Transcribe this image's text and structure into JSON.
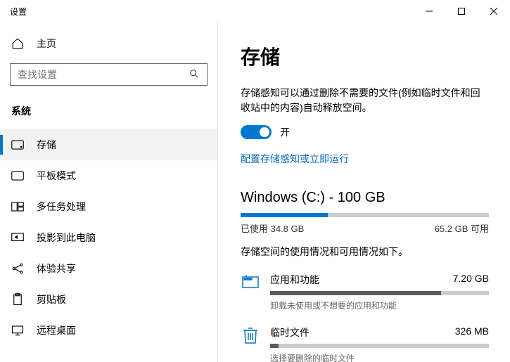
{
  "window": {
    "title": "设置"
  },
  "sidebar": {
    "home": "主页",
    "search_placeholder": "查找设置",
    "section": "系统",
    "items": [
      {
        "label": "存储"
      },
      {
        "label": "平板模式"
      },
      {
        "label": "多任务处理"
      },
      {
        "label": "投影到此电脑"
      },
      {
        "label": "体验共享"
      },
      {
        "label": "剪贴板"
      },
      {
        "label": "远程桌面"
      }
    ]
  },
  "main": {
    "title": "存储",
    "description": "存储感知可以通过删除不需要的文件(例如临时文件和回收站中的内容)自动释放空间。",
    "toggle_state": "开",
    "config_link": "配置存储感知或立即运行",
    "drive": {
      "title": "Windows (C:) - 100 GB",
      "used_pct": 35,
      "used_text": "已使用 34.8 GB",
      "free_text": "65.2 GB 可用",
      "sub_desc": "存储空间的使用情况和可用情况如下。"
    },
    "categories": [
      {
        "name": "应用和功能",
        "size": "7.20 GB",
        "pct": 78,
        "hint": "卸载未使用或不想要的应用和功能"
      },
      {
        "name": "临时文件",
        "size": "326 MB",
        "pct": 4,
        "hint": "选择要删除的临时文件"
      }
    ]
  }
}
